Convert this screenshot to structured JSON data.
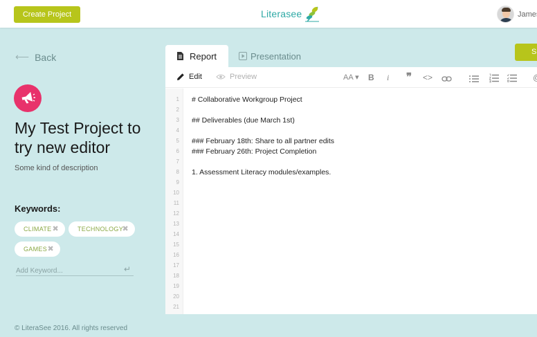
{
  "topbar": {
    "create_label": "Create Project",
    "logo_text": "Literasee",
    "user_name": "James"
  },
  "sidebar": {
    "back_label": "Back",
    "title": "My Test Project to try new editor",
    "description": "Some kind of description",
    "keywords_label": "Keywords:",
    "keywords": [
      "CLIMATE",
      "TECHNOLOGY",
      "GAMES"
    ],
    "keyword_placeholder": "Add Keyword...",
    "footer": "© LiteraSee 2016. All rights reserved"
  },
  "tabs": {
    "report_label": "Report",
    "presentation_label": "Presentation",
    "save_label": "S"
  },
  "editor": {
    "edit_label": "Edit",
    "preview_label": "Preview",
    "font_size_label": "AA",
    "line_numbers": [
      "1",
      "2",
      "3",
      "4",
      "5",
      "6",
      "7",
      "8",
      "9",
      "10",
      "11",
      "12",
      "13",
      "14",
      "15",
      "16",
      "17",
      "18",
      "19",
      "20",
      "21"
    ],
    "lines": [
      "# Collaborative Workgroup Project",
      "",
      "## Deliverables (due March 1st)",
      "",
      "### February 18th: Share to all partner edits",
      "### February 26th: Project Completion",
      "",
      "1. Assessment Literacy modules/examples."
    ]
  },
  "colors": {
    "background": "#cde9ea",
    "accent_green": "#b7c51b",
    "logo_teal": "#2ea9a5",
    "project_icon": "#e8326b",
    "chip_text": "#8aa844"
  },
  "icons": [
    "arrow-left-icon",
    "megaphone-icon",
    "document-icon",
    "play-icon",
    "pencil-icon",
    "eye-icon",
    "bold-icon",
    "italic-icon",
    "quote-icon",
    "code-icon",
    "link-icon",
    "bullet-list-icon",
    "numbered-list-icon",
    "task-list-icon",
    "leaf-logo-icon",
    "enter-icon",
    "close-icon"
  ]
}
